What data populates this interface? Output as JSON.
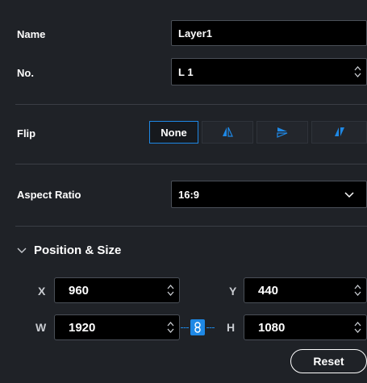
{
  "name": {
    "label": "Name",
    "value": "Layer1"
  },
  "number": {
    "label": "No.",
    "value": "L 1"
  },
  "flip": {
    "label": "Flip",
    "options": [
      {
        "label": "None",
        "icon": "none",
        "selected": true
      },
      {
        "label": "",
        "icon": "flip-horizontal-icon",
        "selected": false
      },
      {
        "label": "",
        "icon": "flip-vertical-icon",
        "selected": false
      },
      {
        "label": "",
        "icon": "flip-both-icon",
        "selected": false
      }
    ]
  },
  "aspect_ratio": {
    "label": "Aspect Ratio",
    "value": "16:9"
  },
  "position_size": {
    "title": "Position & Size",
    "x": {
      "label": "X",
      "value": "960"
    },
    "y": {
      "label": "Y",
      "value": "440"
    },
    "w": {
      "label": "W",
      "value": "1920"
    },
    "h": {
      "label": "H",
      "value": "1080"
    },
    "link_locked": true,
    "reset_label": "Reset"
  },
  "colors": {
    "accent": "#1e88e5",
    "background": "#1f2227",
    "field": "#000000"
  }
}
